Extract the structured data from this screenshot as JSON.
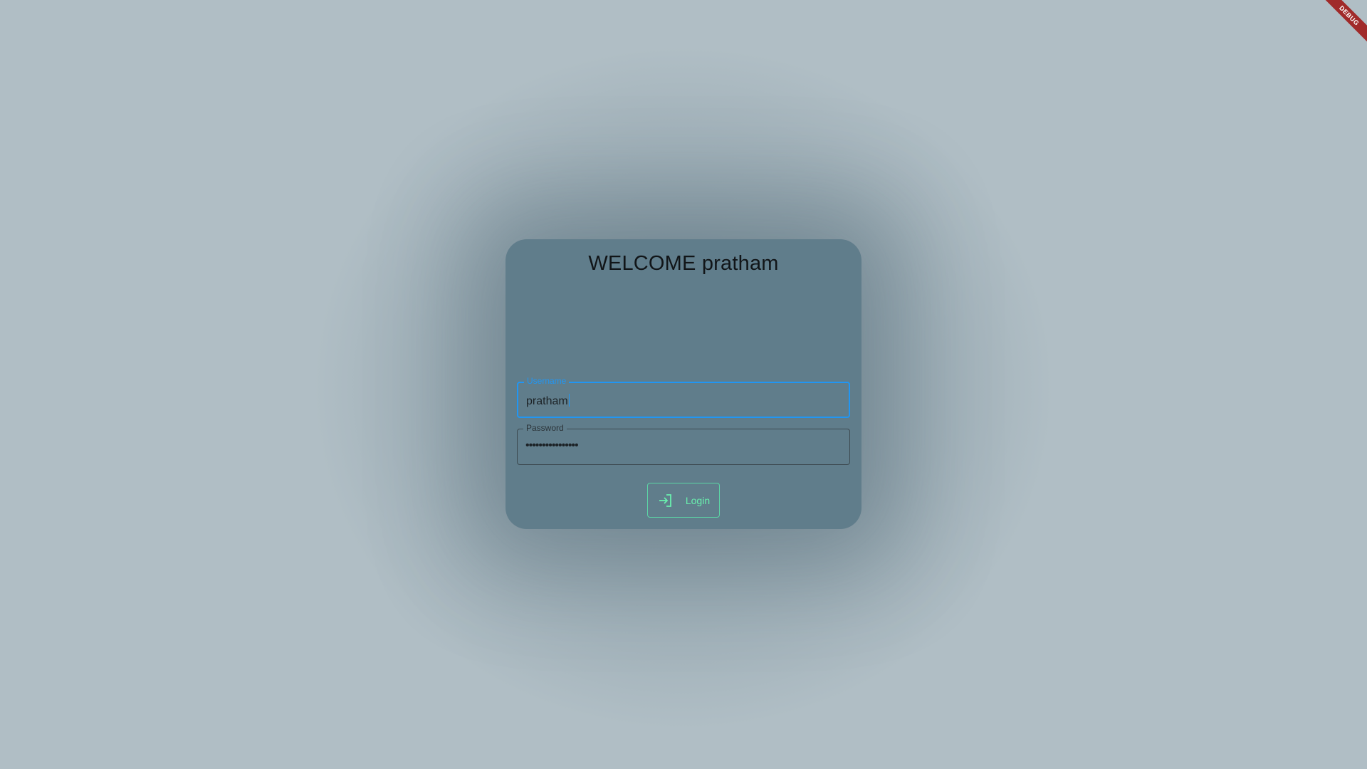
{
  "login_card": {
    "title": "WELCOME pratham",
    "username": {
      "label": "Username",
      "value": "pratham"
    },
    "password": {
      "label": "Password",
      "value": "••••••••••••••••"
    },
    "login_button": {
      "label": "Login",
      "icon": "login-icon"
    }
  },
  "debug_banner": {
    "label": "DEBUG"
  },
  "colors": {
    "background": "#b0bec5",
    "card": "#607d8b",
    "focus_accent": "#2196f3",
    "button_accent": "#69f0ae",
    "debug_ribbon": "#a02a2a"
  }
}
